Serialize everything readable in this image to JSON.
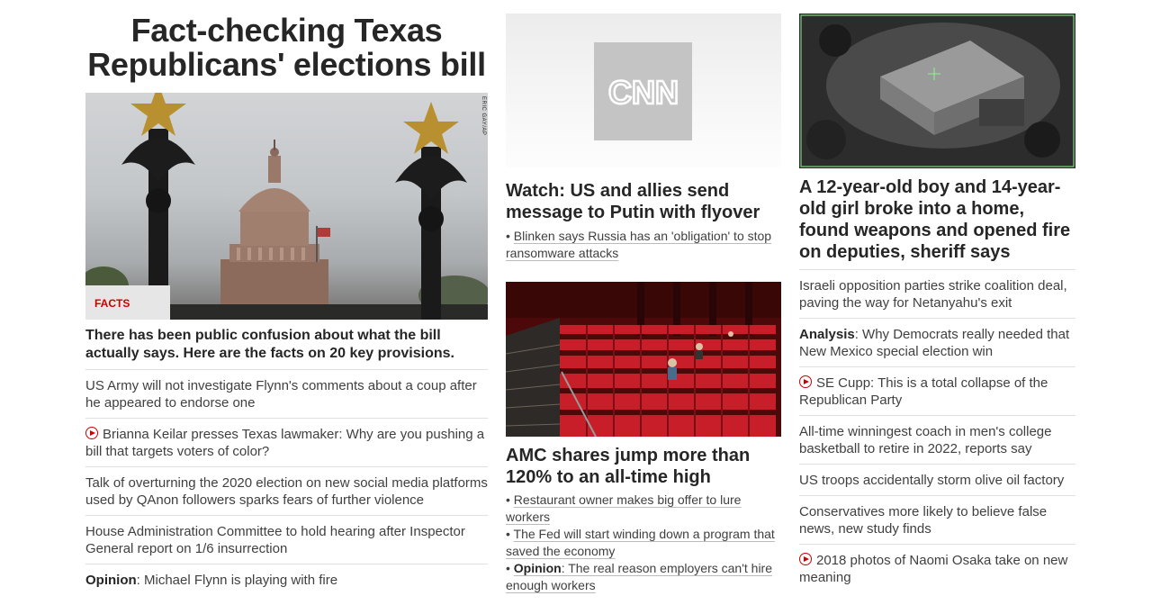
{
  "col1": {
    "headline": "Fact-checking Texas Republicans' elections bill",
    "photo_credit": "ERIC GAY/AP",
    "badge": "FACTS FIRST",
    "hero_description": "There has been public confusion about what the bill actually says. Here are the facts on 20 key provisions.",
    "items": [
      {
        "text": "US Army will not investigate Flynn's comments about a coup after he appeared to endorse one"
      },
      {
        "text": "Brianna Keilar presses Texas lawmaker: Why are you pushing a bill that targets voters of color?",
        "video": true
      },
      {
        "text": "Talk of overturning the 2020 election on new social media platforms used by QAnon followers sparks fears of further violence"
      },
      {
        "text": "House Administration Committee to hold hearing after Inspector General report on 1/6 insurrection"
      },
      {
        "prefix": "Opinion",
        "text": ": Michael Flynn is playing with fire"
      }
    ]
  },
  "col2": {
    "logo_text": "CNN",
    "card1": {
      "headline": "Watch: US and allies send message to Putin with flyover",
      "links": [
        "Blinken says Russia has an 'obligation' to stop ransomware attacks"
      ]
    },
    "card2": {
      "headline": "AMC shares jump more than 120% to an all-time high",
      "links": [
        {
          "text": "Restaurant owner makes big offer to lure workers"
        },
        {
          "text": "The Fed will start winding down a program that saved the economy"
        },
        {
          "prefix": "Opinion",
          "text": ": The real reason employers can't hire enough workers"
        }
      ]
    }
  },
  "col3": {
    "headline": "A 12-year-old boy and 14-year-old girl broke into a home, found weapons and opened fire on deputies, sheriff says",
    "items": [
      {
        "text": "Israeli opposition parties strike coalition deal, paving the way for Netanyahu's exit"
      },
      {
        "prefix": "Analysis",
        "text": ": Why Democrats really needed that New Mexico special election win"
      },
      {
        "text": "SE Cupp: This is a total collapse of the Republican Party",
        "video": true
      },
      {
        "text": "All-time winningest coach in men's college basketball to retire in 2022, reports say"
      },
      {
        "text": "US troops accidentally storm olive oil factory"
      },
      {
        "text": "Conservatives more likely to believe false news, new study finds"
      },
      {
        "text": "2018 photos of Naomi Osaka take on new meaning",
        "video": true
      }
    ]
  },
  "colors": {
    "accent": "#cc0000",
    "text": "#262626",
    "muted": "#404040",
    "divider": "#e0e0e0"
  }
}
